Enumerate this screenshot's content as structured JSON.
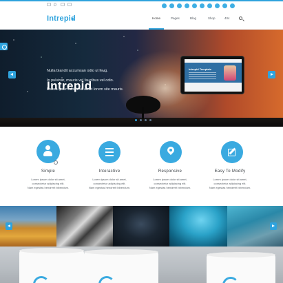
{
  "brand": {
    "name": "Intrepid",
    "accent": "#2fa3dd"
  },
  "topbar": {
    "contact_icons": [
      "mail-icon",
      "map-pin-icon",
      "edit-icon",
      "chat-icon"
    ],
    "social_icons": [
      "facebook-icon",
      "twitter-icon",
      "google-plus-icon",
      "linkedin-icon",
      "pinterest-icon",
      "skype-icon",
      "youtube-icon",
      "dribbble-icon",
      "flickr-icon",
      "vimeo-icon"
    ]
  },
  "nav": {
    "items": [
      {
        "label": "Home",
        "active": true
      },
      {
        "label": "Pages",
        "active": false
      },
      {
        "label": "Blog",
        "active": false
      },
      {
        "label": "Shop",
        "active": false
      },
      {
        "label": "404",
        "active": false
      }
    ]
  },
  "hero": {
    "title": "Intrepid",
    "lines": [
      "Nulla blandit accumsan odio ut feug.",
      "In pulvinar, mauris vel faucibus vel odio.",
      "Lorem ipsum dolor sit amet lorem site mauris."
    ],
    "tablet_title": "Intrepid Template",
    "slide_count": 4,
    "active_slide": 1
  },
  "features": [
    {
      "icon": "user-icon",
      "title": "Simple",
      "lines": [
        "Lorem ipsum dolor sit amet,",
        "consectetur adipiscing elit.",
        "Nam egestas hendrerit bibendum."
      ]
    },
    {
      "icon": "menu-icon",
      "title": "Interactive",
      "lines": [
        "Lorem ipsum dolor sit amet,",
        "consectetur adipiscing elit.",
        "Nam egestas hendrerit bibendum."
      ]
    },
    {
      "icon": "map-pin-icon",
      "title": "Responsive",
      "lines": [
        "Lorem ipsum dolor sit amet,",
        "consectetur adipiscing elit.",
        "Nam egestas hendrerit bibendum."
      ]
    },
    {
      "icon": "edit-icon",
      "title": "Easy To Modify",
      "lines": [
        "Lorem ipsum dolor sit amet,",
        "consectetur adipiscing elit.",
        "Nam egestas hendrerit bibendum."
      ]
    }
  ],
  "gallery": {
    "images": [
      "wheat-field-image",
      "bw-abstract-image",
      "dark-leaves-image",
      "underwater-image",
      "diver-image"
    ]
  }
}
